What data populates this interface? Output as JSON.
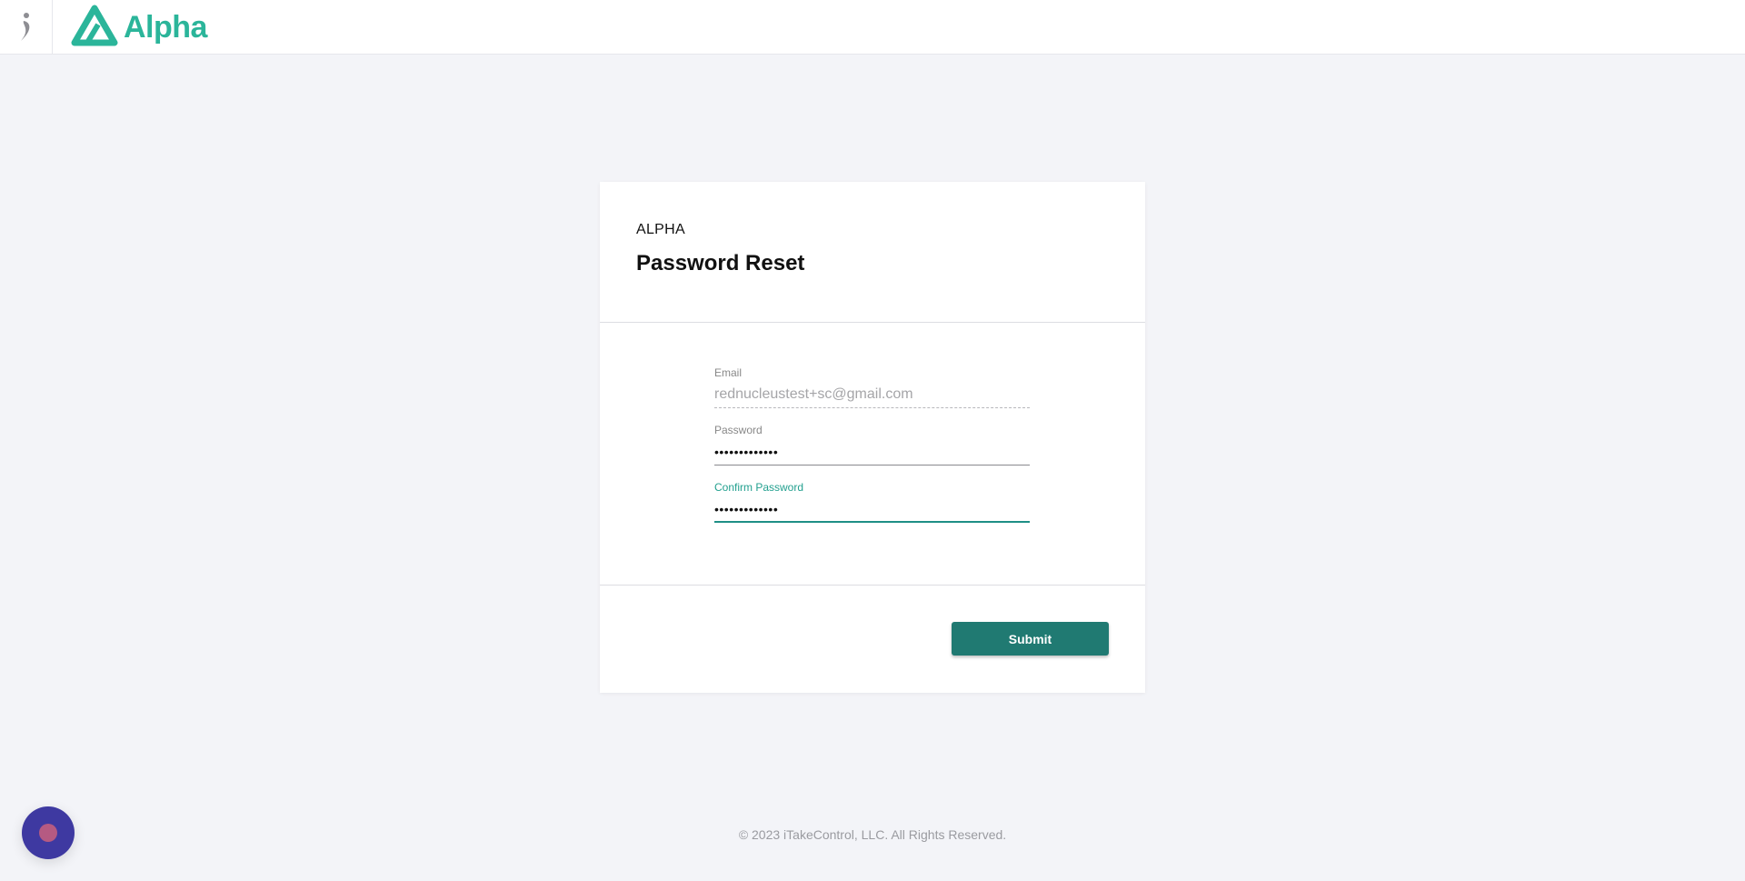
{
  "brand": {
    "name": "Alpha",
    "accent_color": "#2bb59a",
    "side_logo_icon": "person-figure-icon",
    "logo_icon": "alpha-triangle-icon"
  },
  "card": {
    "eyebrow": "ALPHA",
    "title": "Password Reset",
    "fields": {
      "email": {
        "label": "Email",
        "value": "rednucleustest+sc@gmail.com"
      },
      "password": {
        "label": "Password",
        "value": "•••••••••••••"
      },
      "confirm_password": {
        "label": "Confirm Password",
        "value": "•••••••••••••"
      }
    },
    "submit_label": "Submit",
    "button_color": "#207a72"
  },
  "footer": {
    "copyright": "© 2023 iTakeControl, LLC. All Rights Reserved."
  },
  "chat": {
    "icon": "chat-launcher-icon"
  }
}
